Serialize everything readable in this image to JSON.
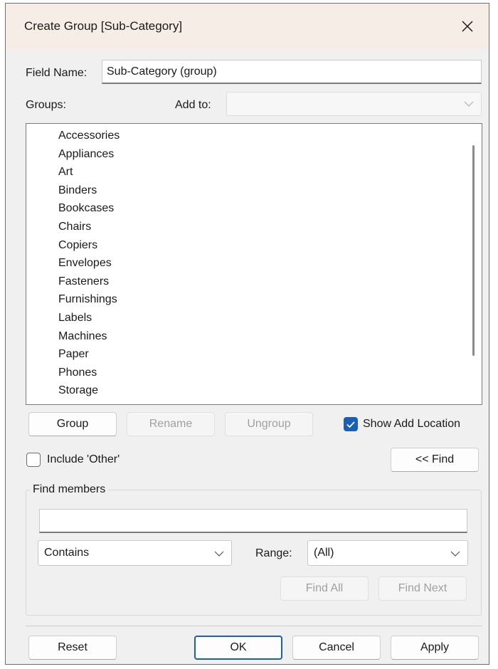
{
  "window": {
    "title": "Create Group [Sub-Category]"
  },
  "field_name": {
    "label": "Field Name:",
    "value": "Sub-Category (group)"
  },
  "groups_label": "Groups:",
  "add_to": {
    "label": "Add to:",
    "value": ""
  },
  "members": [
    "Accessories",
    "Appliances",
    "Art",
    "Binders",
    "Bookcases",
    "Chairs",
    "Copiers",
    "Envelopes",
    "Fasteners",
    "Furnishings",
    "Labels",
    "Machines",
    "Paper",
    "Phones",
    "Storage"
  ],
  "buttons": {
    "group": "Group",
    "rename": "Rename",
    "ungroup": "Ungroup",
    "find_toggle": "<< Find",
    "find_all": "Find All",
    "find_next": "Find Next",
    "reset": "Reset",
    "ok": "OK",
    "cancel": "Cancel",
    "apply": "Apply"
  },
  "show_add_location": {
    "label": "Show Add Location",
    "checked": true
  },
  "include_other": {
    "label": "Include 'Other'",
    "checked": false
  },
  "find_members": {
    "title": "Find members",
    "search_value": "",
    "match_mode": "Contains",
    "range_label": "Range:",
    "range_value": "(All)"
  },
  "colors": {
    "accent": "#1a5fb4",
    "titlebar": "#f5ede6",
    "dialog_bg": "#f0f0f0"
  }
}
